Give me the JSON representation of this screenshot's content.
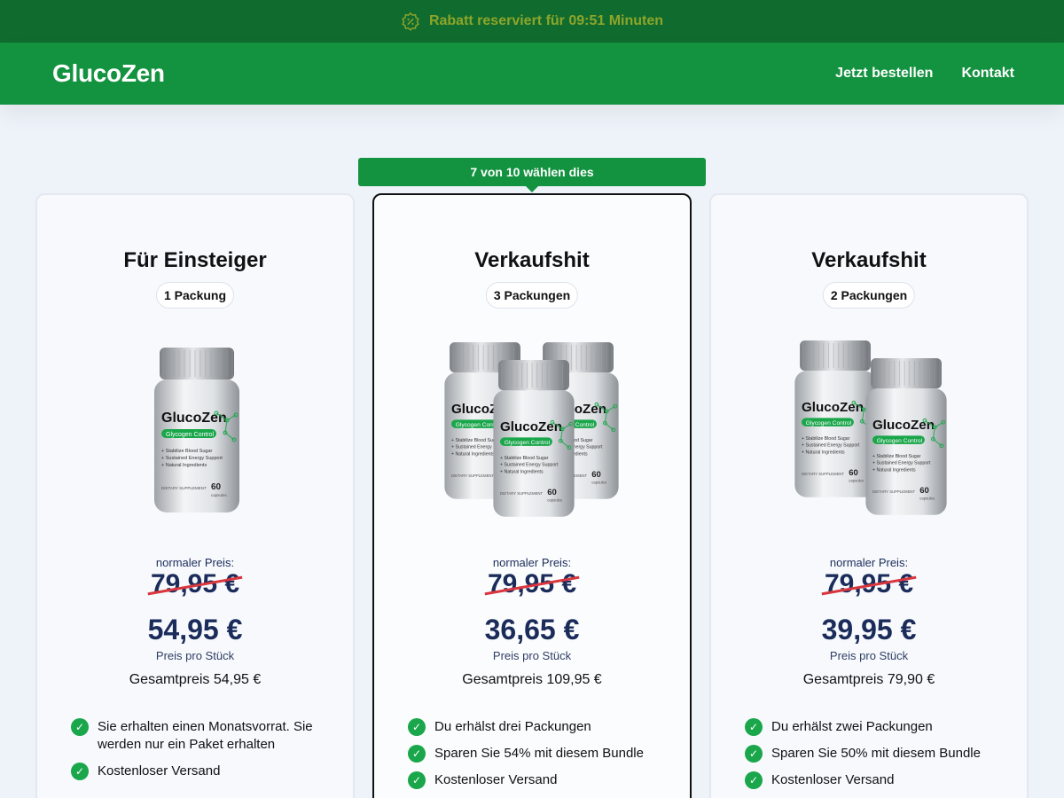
{
  "topbar": {
    "text": "Rabatt reserviert für 09:51 Minuten",
    "icon": "discount-badge-icon"
  },
  "header": {
    "logo": "GlucoZen",
    "nav": [
      {
        "label": "Jetzt bestellen"
      },
      {
        "label": "Kontakt"
      }
    ]
  },
  "popular_tag": "7 von 10 wählen dies",
  "colors": {
    "accent": "#13923f",
    "topbar": "#106b2f",
    "price": "#1b2c5a",
    "strike": "#d9363e"
  },
  "cards": [
    {
      "title": "Für Einsteiger",
      "pack": "1 Packung",
      "bottles": 1,
      "normal_label": "normaler Preis:",
      "old_price": "79,95 €",
      "new_price": "54,95 €",
      "unit": "Preis pro Stück",
      "total": "Gesamtpreis 54,95 €",
      "features": [
        "Sie erhalten einen Monatsvorrat. Sie werden nur ein Paket erhalten",
        "Kostenloser Versand"
      ]
    },
    {
      "title": "Verkaufshit",
      "pack": "3 Packungen",
      "bottles": 3,
      "normal_label": "normaler Preis:",
      "old_price": "79,95 €",
      "new_price": "36,65 €",
      "unit": "Preis pro Stück",
      "total": "Gesamtpreis 109,95 €",
      "features": [
        "Du erhälst drei Packungen",
        "Sparen Sie 54% mit diesem Bundle",
        "Kostenloser Versand"
      ]
    },
    {
      "title": "Verkaufshit",
      "pack": "2 Packungen",
      "bottles": 2,
      "normal_label": "normaler Preis:",
      "old_price": "79,95 €",
      "new_price": "39,95 €",
      "unit": "Preis pro Stück",
      "total": "Gesamtpreis 79,90 €",
      "features": [
        "Du erhälst zwei Packungen",
        "Sparen Sie 50% mit diesem Bundle",
        "Kostenloser Versand"
      ]
    }
  ],
  "bottle_label": {
    "brand": "GlucoZen",
    "tag": "Glycogen Control",
    "lines": [
      "Stabilize Blood Sugar",
      "Sustained Energy Support",
      "Natural Ingredients"
    ],
    "footer": "DIETARY SUPPLEMENT",
    "count": "60",
    "count_unit": "capsules"
  }
}
